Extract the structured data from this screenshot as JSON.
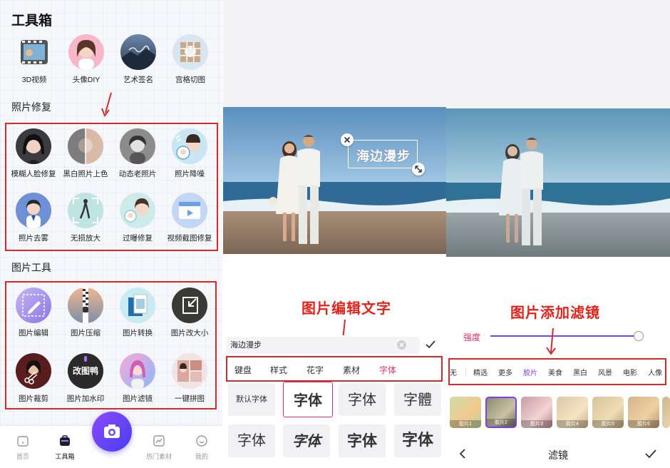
{
  "panel1": {
    "title": "工具箱",
    "top_tools": [
      {
        "label": "3D视频",
        "icon": "film-reel-icon"
      },
      {
        "label": "头像DIY",
        "icon": "girl-avatar-icon"
      },
      {
        "label": "艺术签名",
        "icon": "signature-photo-icon"
      },
      {
        "label": "宫格切图",
        "icon": "grid-cut-icon"
      }
    ],
    "section_photo_repair": "照片修复",
    "photo_repair_tools": [
      {
        "label": "模糊人脸修复",
        "icon": "face-restore-icon"
      },
      {
        "label": "黑白照片上色",
        "icon": "colorize-icon"
      },
      {
        "label": "动态老照片",
        "icon": "animate-photo-icon"
      },
      {
        "label": "照片降噪",
        "icon": "denoise-icon"
      },
      {
        "label": "照片去雾",
        "icon": "dehaze-icon"
      },
      {
        "label": "无损放大",
        "icon": "upscale-icon"
      },
      {
        "label": "过曝修复",
        "icon": "overexposure-icon"
      },
      {
        "label": "视频截图修复",
        "icon": "video-frame-icon"
      }
    ],
    "section_image_tools": "图片工具",
    "image_tools": [
      {
        "label": "图片编辑",
        "icon": "edit-pen-icon"
      },
      {
        "label": "图片压缩",
        "icon": "zip-compress-icon"
      },
      {
        "label": "图片转换",
        "icon": "convert-icon"
      },
      {
        "label": "图片改大小",
        "icon": "resize-icon"
      },
      {
        "label": "图片裁剪",
        "icon": "crop-scissors-icon"
      },
      {
        "label": "图片加水印",
        "icon": "watermark-icon"
      },
      {
        "label": "图片滤镜",
        "icon": "filter-icon"
      },
      {
        "label": "一键拼图",
        "icon": "collage-icon"
      }
    ],
    "watermark_text": "改图鸭",
    "tabbar": [
      {
        "label": "首页",
        "icon": "home-icon"
      },
      {
        "label": "工具箱",
        "icon": "toolbox-icon"
      },
      {
        "label": "热门素材",
        "icon": "hot-material-icon"
      },
      {
        "label": "我的",
        "icon": "profile-icon"
      }
    ],
    "camera_icon": "camera-icon"
  },
  "panel2": {
    "overlay_text": "海边漫步",
    "caption": "图片编辑文字",
    "text_input_value": "海边漫步",
    "tabs": [
      "键盘",
      "样式",
      "花字",
      "素材",
      "字体"
    ],
    "active_tab": "字体",
    "fonts": [
      "默认字体",
      "字体",
      "字体",
      "字體",
      "字体",
      "字体",
      "字体",
      "字体"
    ]
  },
  "panel3": {
    "caption": "图片添加滤镜",
    "strength_label": "强度",
    "strength_value": 0.99,
    "filter_tabs": [
      "无",
      "精选",
      "更多",
      "胶片",
      "美食",
      "黑白",
      "风景",
      "电影",
      "人像"
    ],
    "active_filter_tab": "胶片",
    "thumbs": [
      "胶片1",
      "胶片2",
      "胶片3",
      "胶片4",
      "胶片5",
      "胶片6"
    ],
    "bottom_title": "滤镜"
  },
  "colors": {
    "accent_purple": "#7b3ff2",
    "highlight_red": "#e0241c",
    "box_red": "#d32b2b"
  }
}
